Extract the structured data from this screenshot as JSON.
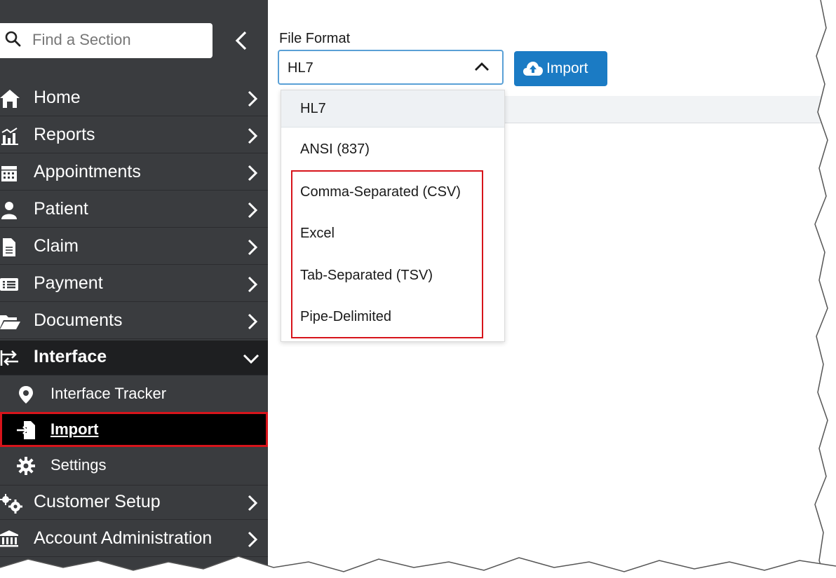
{
  "sidebar": {
    "search_placeholder": "Find a Section",
    "items": [
      {
        "label": "Home",
        "icon": "home-icon"
      },
      {
        "label": "Reports",
        "icon": "reports-icon"
      },
      {
        "label": "Appointments",
        "icon": "calendar-icon"
      },
      {
        "label": "Patient",
        "icon": "user-icon"
      },
      {
        "label": "Claim",
        "icon": "document-icon"
      },
      {
        "label": "Payment",
        "icon": "payment-icon"
      },
      {
        "label": "Documents",
        "icon": "folder-icon"
      },
      {
        "label": "Interface",
        "icon": "exchange-icon"
      }
    ],
    "interface_subitems": [
      {
        "label": "Interface Tracker",
        "icon": "map-pin-icon"
      },
      {
        "label": "Import",
        "icon": "file-import-icon"
      },
      {
        "label": "Settings",
        "icon": "gear-icon"
      }
    ],
    "bottom_items": [
      {
        "label": "Customer Setup",
        "icon": "gears-icon"
      },
      {
        "label": "Account Administration",
        "icon": "bank-icon"
      }
    ]
  },
  "main": {
    "file_format_label": "File Format",
    "selected_value": "HL7",
    "import_label": "Import",
    "options": [
      "HL7",
      "ANSI (837)",
      "Comma-Separated (CSV)",
      "Excel",
      "Tab-Separated (TSV)",
      "Pipe-Delimited"
    ]
  },
  "colors": {
    "sidebar_bg": "#3a3c3f",
    "active_bg": "#1e1f21",
    "accent_blue": "#1b7bc4",
    "highlight_red": "#d7141b"
  }
}
